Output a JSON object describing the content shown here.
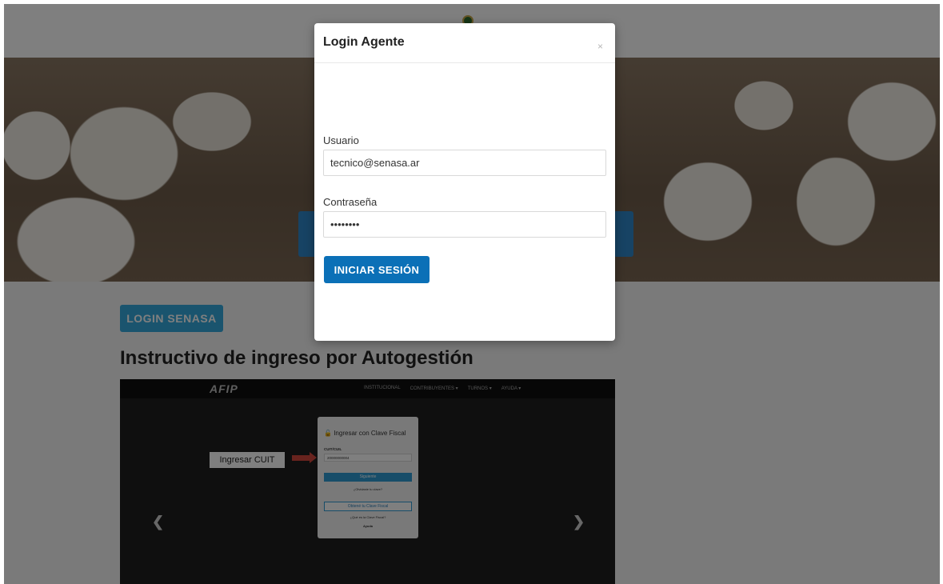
{
  "page": {
    "login_button_label": "LOGIN SENASA",
    "heading": "Instructivo de ingreso por Autogestión"
  },
  "carousel": {
    "logo_text": "AFIP",
    "nav_links": [
      "INSTITUCIONAL",
      "CONTRIBUYENTES ▾",
      "TURNOS ▾",
      "AYUDA ▾"
    ],
    "callout_label": "Ingresar CUIT",
    "card": {
      "title": "Ingresar con Clave Fiscal",
      "field_label": "CUIT/CUIL",
      "field_value": "20000000004",
      "next_button": "Siguiente",
      "forgot_link": "¿Olvidaste tu clave?",
      "get_key_button": "Obtené tu Clave Fiscal",
      "what_is_link": "¿Qué es la Clave Fiscal?",
      "help_link": "Ayuda"
    },
    "prev_icon": "chevron-left-icon",
    "next_icon": "chevron-right-icon"
  },
  "modal": {
    "title": "Login Agente",
    "close_icon": "×",
    "username_label": "Usuario",
    "username_value": "tecnico@senasa.ar",
    "password_label": "Contraseña",
    "password_value": "••••••••",
    "submit_label": "INICIAR SESIÓN"
  },
  "colors": {
    "primary_button": "#0b70b7",
    "secondary_button": "#34a8dc",
    "overlay": "rgba(0,0,0,0.5)"
  }
}
